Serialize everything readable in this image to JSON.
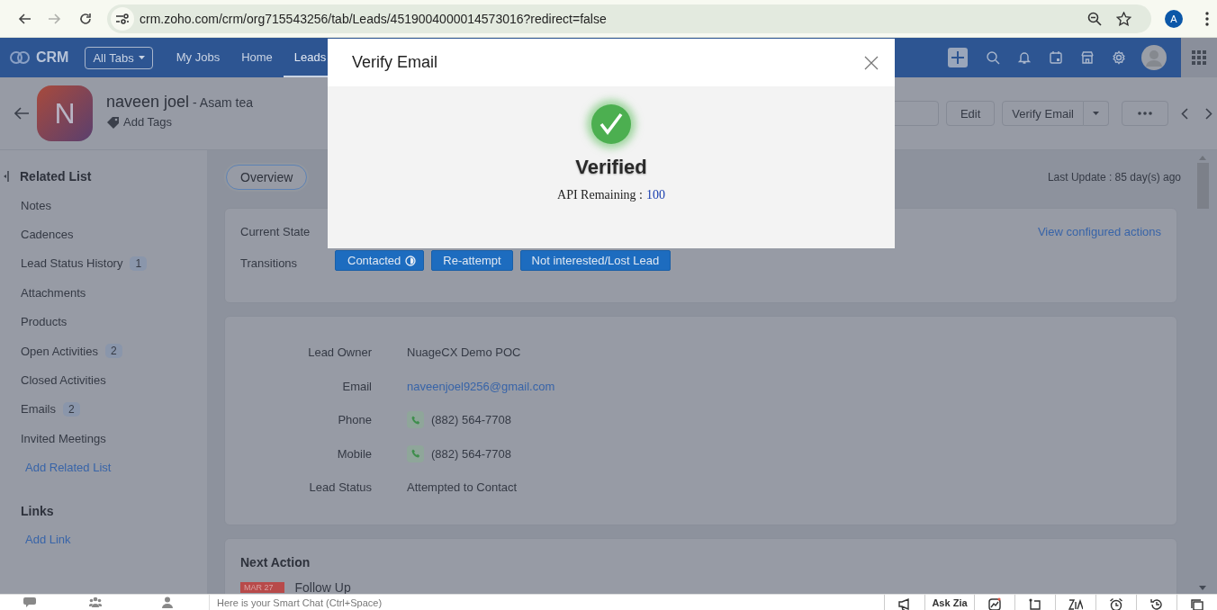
{
  "browser": {
    "url": "crm.zoho.com/crm/org715543256/tab/Leads/4519004000014573016?redirect=false",
    "profile_initial": "A",
    "nav": [
      {
        "kind": "back",
        "disabled": false
      },
      {
        "kind": "forward",
        "disabled": true
      },
      {
        "kind": "reload",
        "disabled": false
      }
    ]
  },
  "app_nav": {
    "logo": "CRM",
    "all_tabs": "All Tabs",
    "tabs": [
      {
        "label": "My Jobs",
        "selected": false
      },
      {
        "label": "Home",
        "selected": false
      },
      {
        "label": "Leads",
        "selected": true
      }
    ]
  },
  "record": {
    "initial": "N",
    "name": "naveen joel",
    "company": "- Asam tea",
    "add_tags": "Add Tags",
    "actions": [
      {
        "label": "Edit",
        "kind": "plain"
      },
      {
        "label": "Verify Email",
        "kind": "split"
      }
    ]
  },
  "sidebar": {
    "heading": "Related List",
    "items": [
      {
        "label": "Notes"
      },
      {
        "label": "Cadences"
      },
      {
        "label": "Lead Status History",
        "count": "1"
      },
      {
        "label": "Attachments"
      },
      {
        "label": "Products"
      },
      {
        "label": "Open Activities",
        "count": "2"
      },
      {
        "label": "Closed Activities"
      },
      {
        "label": "Emails",
        "count": "2"
      },
      {
        "label": "Invited Meetings"
      }
    ],
    "add_related": "Add Related List",
    "links_heading": "Links",
    "add_link": "Add Link"
  },
  "view_tabs": [
    {
      "label": "Overview",
      "selected": true
    }
  ],
  "last_update": "Last Update : 85 day(s) ago",
  "blueprint": {
    "current_state_label": "Current State",
    "transitions_label": "Transitions",
    "view_actions": "View configured actions",
    "transitions": [
      {
        "label": "Contacted",
        "timer": true
      },
      {
        "label": "Re-attempt",
        "timer": false
      },
      {
        "label": "Not interested/Lost Lead",
        "timer": false
      }
    ]
  },
  "details": [
    {
      "label": "Lead Owner",
      "value": "NuageCX Demo POC",
      "kind": "text"
    },
    {
      "label": "Email",
      "value": "naveenjoel9256@gmail.com",
      "kind": "link"
    },
    {
      "label": "Phone",
      "value": "(882) 564-7708",
      "kind": "phone"
    },
    {
      "label": "Mobile",
      "value": "(882) 564-7708",
      "kind": "phone"
    },
    {
      "label": "Lead Status",
      "value": "Attempted to Contact",
      "kind": "text"
    }
  ],
  "next_action": {
    "title": "Next Action",
    "items": [
      {
        "date": "MAR 27",
        "title": "Follow Up"
      }
    ]
  },
  "footer": {
    "chat_placeholder": "Here is your Smart Chat (Ctrl+Space)",
    "ask_zia": "Ask Zia"
  },
  "modal": {
    "title": "Verify Email",
    "status": "Verified",
    "api_label": "API Remaining :",
    "api_value": "100"
  }
}
